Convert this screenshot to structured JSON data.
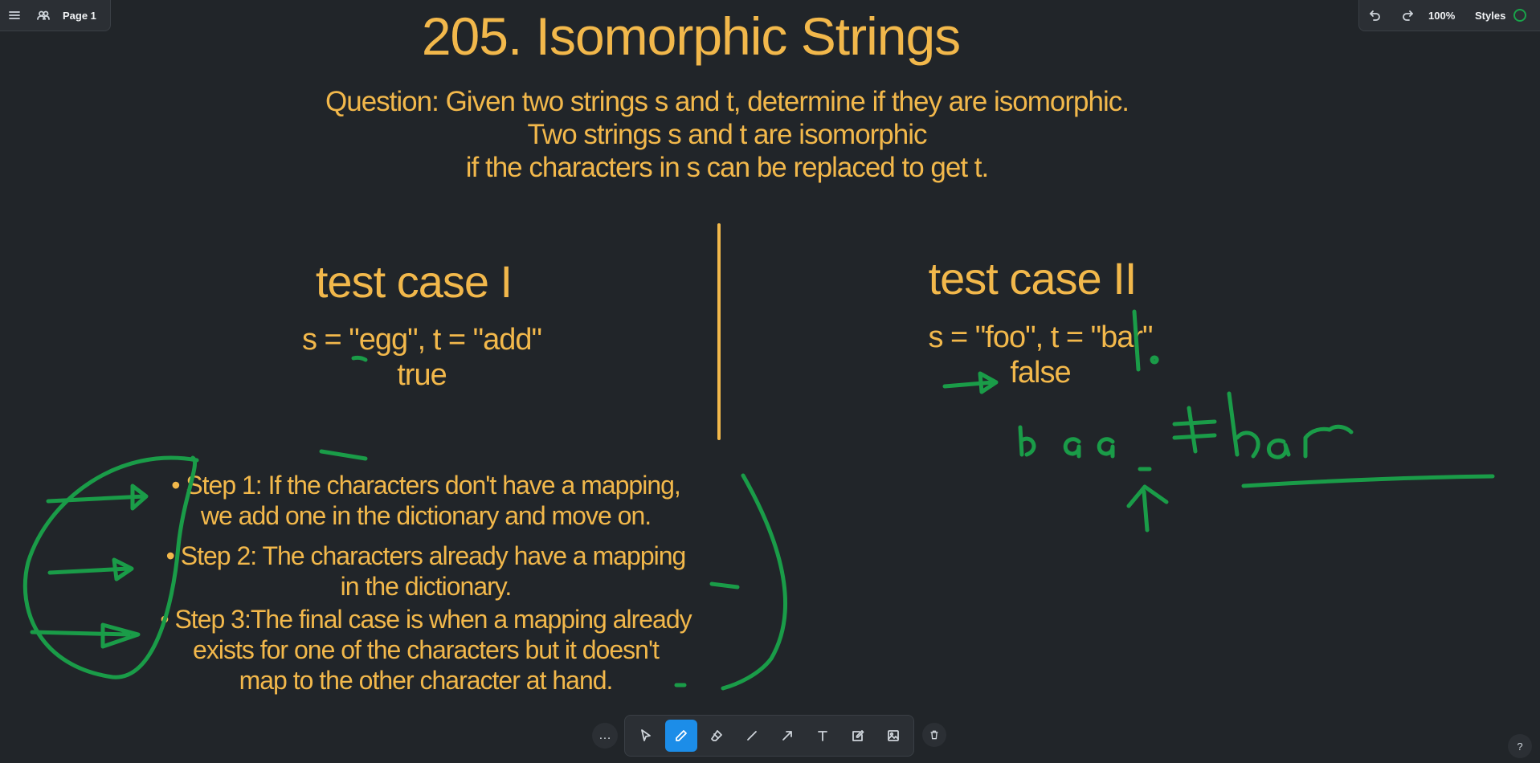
{
  "top_left": {
    "page_label": "Page 1"
  },
  "top_right": {
    "zoom": "100%",
    "styles_label": "Styles"
  },
  "canvas": {
    "title": "205. Isomorphic Strings",
    "question": [
      "Question: Given two strings s and t, determine if they are isomorphic.",
      "Two strings s and t are isomorphic",
      "if the characters in s can be replaced to get t."
    ],
    "case1": {
      "title": "test case I",
      "input": "s = \"egg\", t = \"add\"",
      "output": "true"
    },
    "case2": {
      "title": "test case II",
      "input": "s = \"foo\", t = \"bar\"",
      "output": "false"
    },
    "steps": [
      "• Step 1: If the characters don't have a mapping,",
      "we add one in the dictionary and move on.",
      "• Step 2: The characters already have a mapping",
      "in the dictionary.",
      "• Step 3:The final case is when a mapping already",
      "exists for one of the characters but it doesn't",
      "map to the other character at hand."
    ]
  },
  "toolbar": {
    "more": "…",
    "help": "?"
  },
  "colors": {
    "background": "#212529",
    "text": "#f2b84b",
    "ink": "#1a9c48",
    "accent": "#1c8de8"
  },
  "icons": [
    "menu-icon",
    "people-icon",
    "undo-icon",
    "redo-icon",
    "select-icon",
    "pencil-icon",
    "eraser-icon",
    "line-icon",
    "arrow-icon",
    "text-icon",
    "note-icon",
    "image-icon",
    "trash-icon"
  ]
}
